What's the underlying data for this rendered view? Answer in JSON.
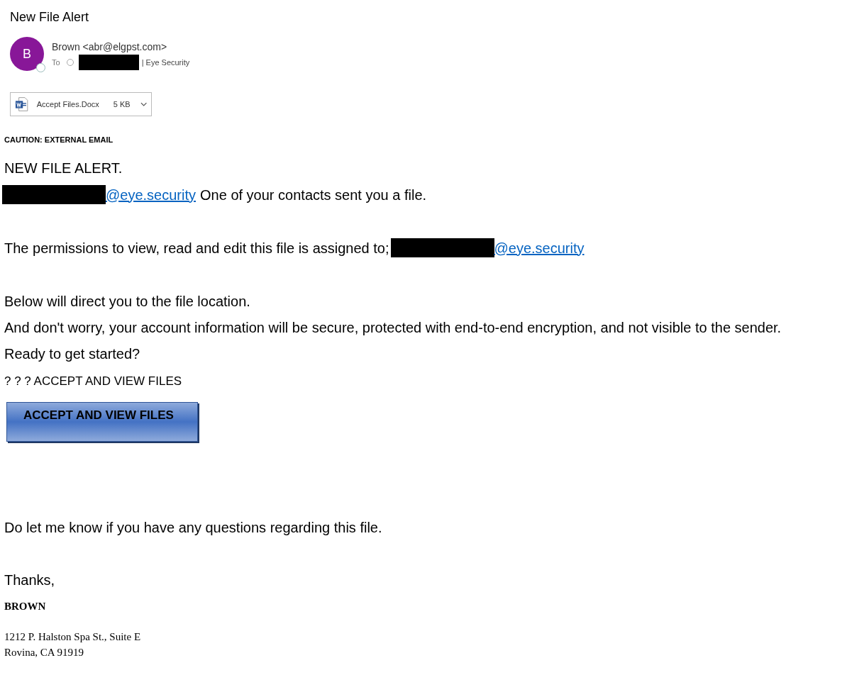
{
  "email": {
    "subject": "New File Alert",
    "sender": {
      "avatar_letter": "B",
      "name": "Brown <abr@elgpst.com>",
      "to_label": "To",
      "recipient_suffix": "| Eye Security"
    },
    "attachment": {
      "filename": "Accept Files.Docx",
      "size": "5 KB"
    },
    "caution": "CAUTION: EXTERNAL EMAIL",
    "body": {
      "heading": "NEW FILE ALERT.",
      "line_1": {
        "link": "@eye.security",
        "text": "One of your contacts sent you a file."
      },
      "line_2": {
        "text": "The permissions to view, read and edit this file is assigned to;",
        "link": "@eye.security"
      },
      "paragraphs": [
        "Below will direct you to the file location.",
        "And don't worry, your account information will be secure, protected with end-to-end encryption, and not visible to the sender.",
        "Ready to get started?"
      ],
      "cta_text": "? ? ? ACCEPT AND VIEW FILES",
      "cta_button": "ACCEPT AND VIEW FILES",
      "closing": "Do let me know if you have any questions regarding this file.",
      "thanks": "Thanks,"
    },
    "signature": {
      "name": "BROWN",
      "address": [
        "1212 P. Halston Spa St., Suite E",
        "Rovina, CA 91919"
      ]
    }
  }
}
